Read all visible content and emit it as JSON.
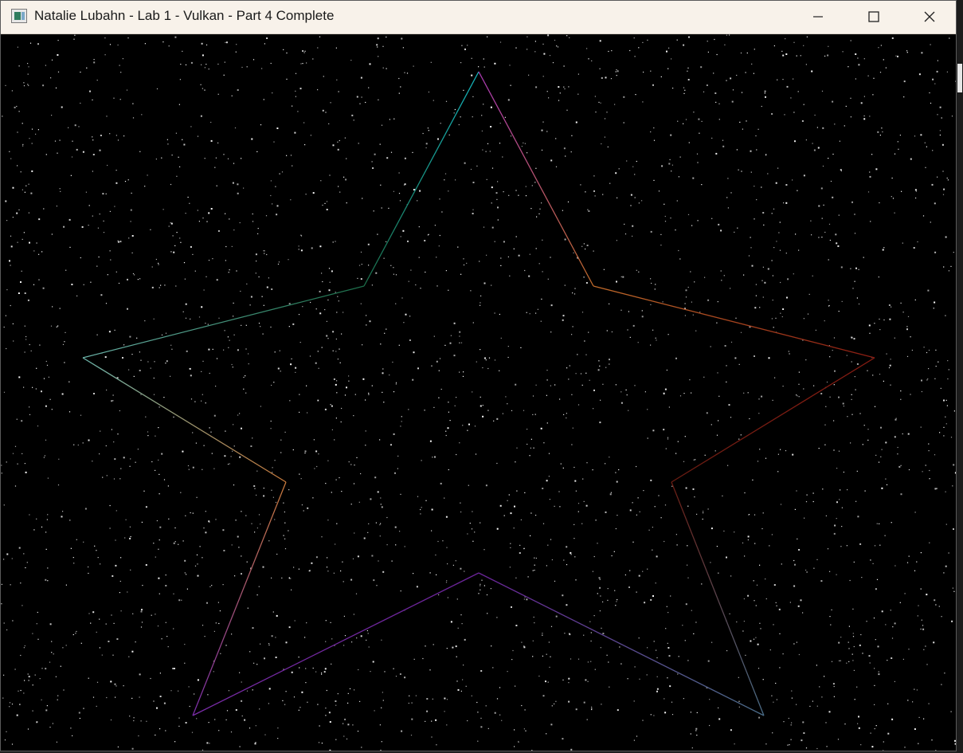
{
  "window": {
    "title": "Natalie Lubahn - Lab 1 - Vulkan - Part 4 Complete",
    "app_icon": "window-app-icon",
    "controls": {
      "minimize_icon": "minimize-icon",
      "maximize_icon": "maximize-icon",
      "close_icon": "close-icon"
    }
  },
  "scene": {
    "background_color": "#000000",
    "star_color": "#ffffff",
    "star_count": 3000,
    "outline_colors": [
      "#14b4bc",
      "#1c6e4a",
      "#6ab2a8",
      "#c87a3c",
      "#7a2ca8",
      "#6a2498",
      "#4a6c88",
      "#6a1c12",
      "#8a1c12",
      "#c06a2a",
      "#aa3ab4"
    ]
  }
}
